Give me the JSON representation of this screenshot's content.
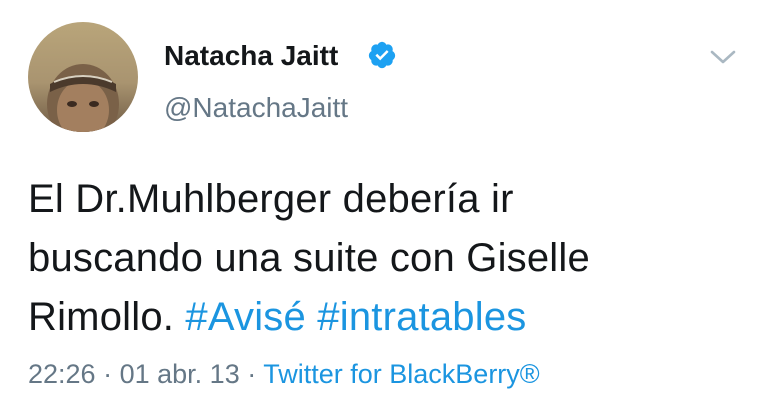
{
  "tweet": {
    "author_name": "Natacha Jaitt",
    "handle": "@NatachaJaitt",
    "verified": true,
    "text_parts": [
      "El Dr.Muhlberger debería ir",
      "buscando una suite con Giselle",
      "Rimollo."
    ],
    "hashtags": [
      "#Avisé",
      "#intratables"
    ],
    "time": "22:26",
    "date": "01 abr. 13",
    "separator": "·",
    "source": "Twitter for BlackBerry®"
  },
  "icons": {
    "avatar": "profile-photo",
    "verified": "verified-badge-icon",
    "caret": "chevron-down-icon"
  },
  "colors": {
    "link": "#1b95e0",
    "verified": "#1da1f2",
    "text": "#14171a",
    "secondary": "#657786"
  }
}
